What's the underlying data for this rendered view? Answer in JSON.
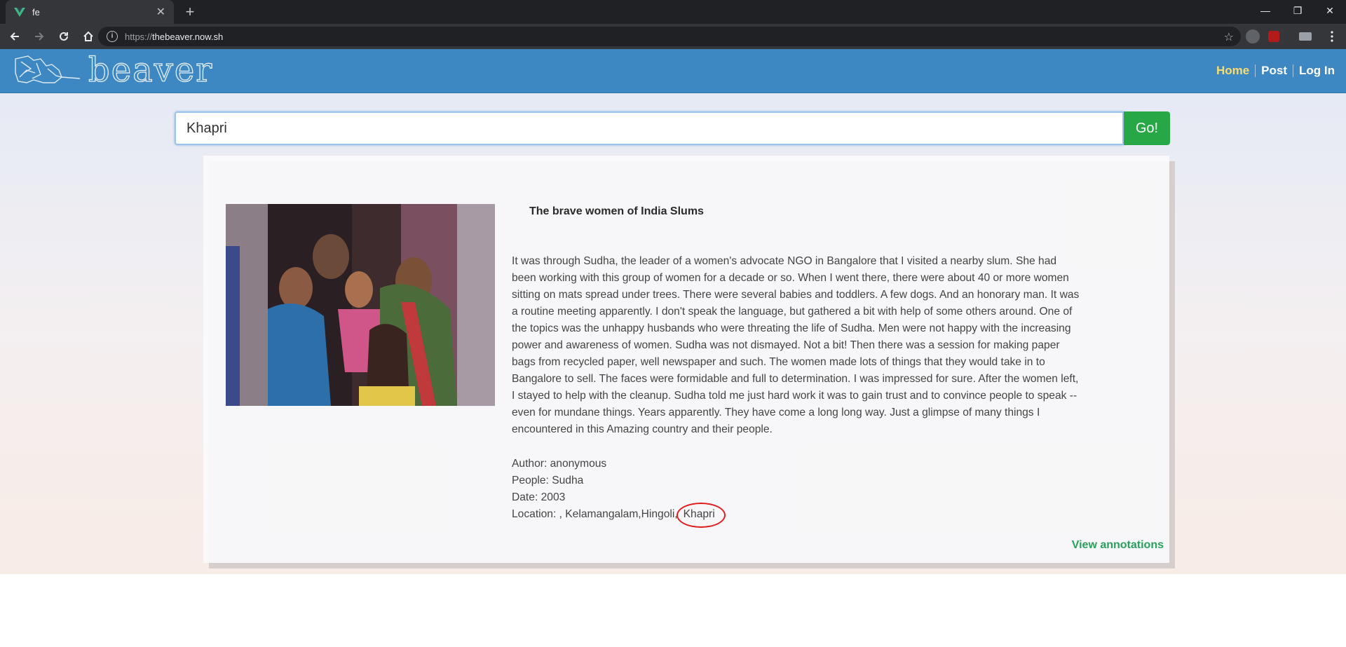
{
  "browser": {
    "tab_title": "fe",
    "url_scheme": "https://",
    "url_host": "thebeaver.now.sh"
  },
  "nav": {
    "brand": "beaver",
    "links": [
      "Home",
      "Post",
      "Log In"
    ]
  },
  "search": {
    "value": "Khapri",
    "button_label": "Go!"
  },
  "post": {
    "title": "The brave women of India Slums",
    "body": "It was through Sudha, the leader of a women's advocate NGO in Bangalore that I visited a nearby slum. She had been working with this group of women for a decade or so. When I went there, there were about 40 or more women sitting on mats spread under trees. There were several babies and toddlers. A few dogs. And an honorary man. It was a routine meeting apparently. I don't speak the language, but gathered a bit with help of some others around. One of the topics was the unhappy husbands who were threating the life of Sudha. Men were not happy with the increasing power and awareness of women. Sudha was not dismayed. Not a bit! Then there was a session for making paper bags from recycled paper, well newspaper and such. The women made lots of things that they would take in to Bangalore to sell. The faces were formidable and full to determination. I was impressed for sure. After the women left, I stayed to help with the cleanup. Sudha told me just hard work it was to gain trust and to convince people to speak -- even for mundane things. Years apparently. They have come a long long way. Just a glimpse of many things I encountered in this Amazing country and their people.",
    "author": "Author: anonymous",
    "people": "People: Sudha",
    "date": "Date: 2003",
    "location_prefix": "Location: , Kelamangalam,Hingoli,",
    "location_highlight": "Khapri",
    "view_annotations": "View annotations"
  }
}
